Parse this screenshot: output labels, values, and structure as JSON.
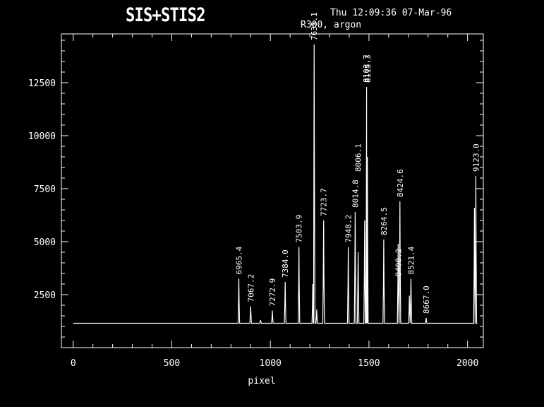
{
  "header": {
    "title": "SIS+STIS2",
    "timestamp": "Thu 12:09:36 07-Mar-96",
    "subtitle": "R300, argon"
  },
  "colors": {
    "background": "#000000",
    "foreground": "#ffffff"
  },
  "chart_data": {
    "type": "line",
    "title": "SIS+STIS2",
    "xlabel": "pixel",
    "ylabel": "",
    "xlim": [
      -60,
      2080
    ],
    "ylim": [
      0,
      14800
    ],
    "xticks": [
      0,
      500,
      1000,
      1500,
      2000
    ],
    "yticks": [
      2500,
      5000,
      7500,
      10000,
      12500
    ],
    "baseline": 1150,
    "grid": false,
    "series": [
      {
        "peaks": [
          {
            "x": 840,
            "y": 3250
          },
          {
            "x": 900,
            "y": 1950
          },
          {
            "x": 950,
            "y": 1300
          },
          {
            "x": 1010,
            "y": 1750
          },
          {
            "x": 1075,
            "y": 3100
          },
          {
            "x": 1145,
            "y": 4750
          },
          {
            "x": 1215,
            "y": 3000
          },
          {
            "x": 1222,
            "y": 14300
          },
          {
            "x": 1235,
            "y": 1800
          },
          {
            "x": 1270,
            "y": 6000
          },
          {
            "x": 1395,
            "y": 4750
          },
          {
            "x": 1430,
            "y": 6400
          },
          {
            "x": 1445,
            "y": 4500
          },
          {
            "x": 1478,
            "y": 6000
          },
          {
            "x": 1488,
            "y": 12300
          },
          {
            "x": 1492,
            "y": 9000
          },
          {
            "x": 1575,
            "y": 5100
          },
          {
            "x": 1648,
            "y": 4900
          },
          {
            "x": 1657,
            "y": 6900
          },
          {
            "x": 1705,
            "y": 2450
          },
          {
            "x": 1713,
            "y": 3250
          },
          {
            "x": 1790,
            "y": 1400
          },
          {
            "x": 2035,
            "y": 6600
          },
          {
            "x": 2042,
            "y": 8100
          }
        ]
      }
    ],
    "annotations": [
      {
        "text": "6965.4",
        "x": 840,
        "y": 3250
      },
      {
        "text": "7067.2",
        "x": 900,
        "y": 1950
      },
      {
        "text": "7272.9",
        "x": 1010,
        "y": 1750
      },
      {
        "text": "7384.0",
        "x": 1075,
        "y": 3100
      },
      {
        "text": "7503.9",
        "x": 1145,
        "y": 4750
      },
      {
        "text": "7635.1",
        "x": 1222,
        "y": 14300
      },
      {
        "text": "7723.7",
        "x": 1270,
        "y": 6000
      },
      {
        "text": "7948.2",
        "x": 1395,
        "y": 4750
      },
      {
        "text": "8014.8",
        "x": 1430,
        "y": 6400
      },
      {
        "text": "8006.1",
        "x": 1445,
        "y": 8100
      },
      {
        "text": "8103.7",
        "x": 1486,
        "y": 12300
      },
      {
        "text": "8115.3",
        "x": 1494,
        "y": 12300
      },
      {
        "text": "8264.5",
        "x": 1575,
        "y": 5100
      },
      {
        "text": "8408.2",
        "x": 1648,
        "y": 3150
      },
      {
        "text": "8424.6",
        "x": 1657,
        "y": 6900
      },
      {
        "text": "8521.4",
        "x": 1713,
        "y": 3250
      },
      {
        "text": "8667.0",
        "x": 1790,
        "y": 1400
      },
      {
        "text": "9123.0",
        "x": 2042,
        "y": 8100
      }
    ]
  }
}
